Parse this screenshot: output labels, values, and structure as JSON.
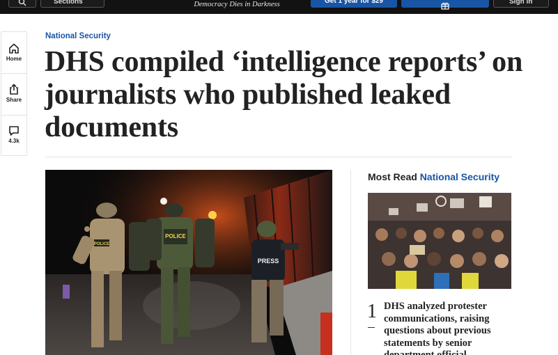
{
  "topbar": {
    "sections_label": "Sections",
    "tagline": "Democracy Dies in Darkness",
    "subscribe_label": "Get 1 year for $29",
    "signin_label": "Sign in"
  },
  "rail": {
    "home_label": "Home",
    "share_label": "Share",
    "comments_count": "4.3k"
  },
  "article": {
    "kicker": "National Security",
    "headline": "DHS compiled ‘intelligence reports’ on journalists who published leaked documents"
  },
  "hero_image": {
    "vest_text_1": "POLICE",
    "vest_text_2": "POLICE",
    "vest_text_3": "PRESS"
  },
  "most_read": {
    "label": "Most Read",
    "section": "National Security",
    "items": [
      {
        "number": "1",
        "title": "DHS analyzed protester communications, raising questions about previous statements by senior department official"
      }
    ]
  },
  "colors": {
    "brand_blue": "#1955a5",
    "topbar": "#121212"
  }
}
